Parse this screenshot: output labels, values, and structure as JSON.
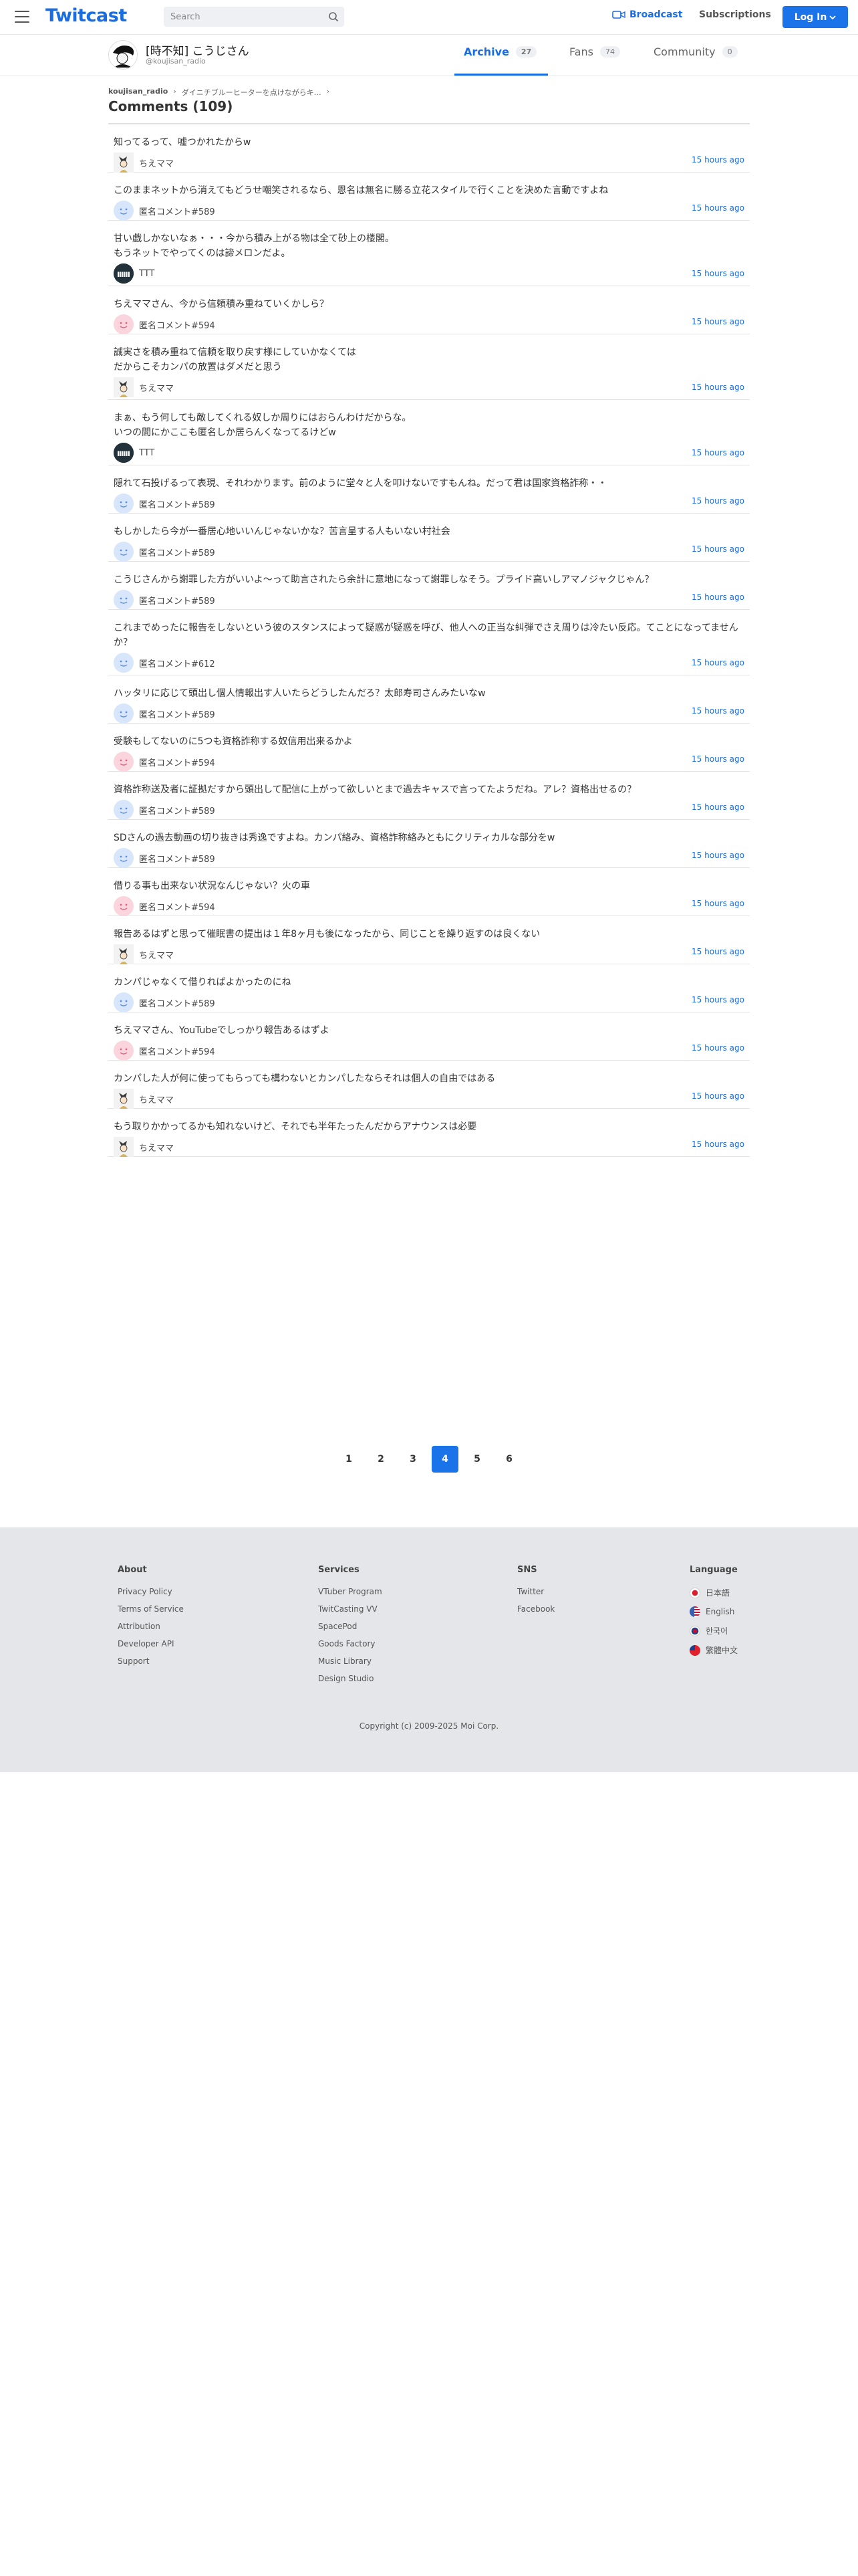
{
  "header": {
    "logo": "Twitcast",
    "search_placeholder": "Search",
    "broadcast": "Broadcast",
    "subscriptions": "Subscriptions",
    "login": "Log In"
  },
  "profile": {
    "name": "[時不知] こうじさん",
    "id": "@koujisan_radio",
    "tabs": [
      {
        "label": "Archive",
        "count": "27"
      },
      {
        "label": "Fans",
        "count": "74"
      },
      {
        "label": "Community",
        "count": "0"
      }
    ]
  },
  "breadcrumb": {
    "user": "koujisan_radio",
    "sep": "›",
    "movie": "ダイニチブルーヒーターを点けながらキ…",
    "sep2": "›"
  },
  "title": "Comments (109)",
  "comments": [
    {
      "text": "知ってるって、嘘つかれたからw",
      "user": "ちえママ",
      "avatar": "mama",
      "time": "15 hours ago"
    },
    {
      "text": "このままネットから消えてもどうせ嘲笑されるなら、恩名は無名に勝る立花スタイルで行くことを決めた言動ですよね",
      "user": "匿名コメント#589",
      "avatar": "blue",
      "time": "15 hours ago"
    },
    {
      "text": "甘い戯しかないなぁ・・・今から積み上がる物は全て砂上の楼閣。\nもうネットでやってくのは諦メロンだよ。",
      "user": "TTT",
      "avatar": "ttt",
      "time": "15 hours ago"
    },
    {
      "text": "ちえママさん、今から信頼積み重ねていくかしら？",
      "user": "匿名コメント#594",
      "avatar": "pink",
      "time": "15 hours ago"
    },
    {
      "text": "誠実さを積み重ねて信頼を取り戻す様にしていかなくては\nだからこそカンパの放置はダメだと思う",
      "user": "ちえママ",
      "avatar": "mama",
      "time": "15 hours ago"
    },
    {
      "text": "まぁ、もう何しても敵してくれる奴しか周りにはおらんわけだからな。\nいつの間にかここも匿名しか居らんくなってるけどw",
      "user": "TTT",
      "avatar": "ttt",
      "time": "15 hours ago"
    },
    {
      "text": "隠れて石投げるって表現、それわかります。前のように堂々と人を叩けないですもんね。だって君は国家資格詐称・・",
      "user": "匿名コメント#589",
      "avatar": "blue",
      "time": "15 hours ago"
    },
    {
      "text": "もしかしたら今が一番居心地いいんじゃないかな？苦言呈する人もいない村社会",
      "user": "匿名コメント#589",
      "avatar": "blue",
      "time": "15 hours ago"
    },
    {
      "text": "こうじさんから謝罪した方がいいよ〜って助言されたら余計に意地になって謝罪しなそう。プライド高いしアマノジャクじゃん？",
      "user": "匿名コメント#589",
      "avatar": "blue",
      "time": "15 hours ago"
    },
    {
      "text": "これまでめったに報告をしないという彼のスタンスによって疑惑が疑惑を呼び、他人への正当な糾弾でさえ周りは冷たい反応。てことになってませんか？",
      "user": "匿名コメント#612",
      "avatar": "blue",
      "time": "15 hours ago"
    },
    {
      "text": "ハッタリに応じて頭出し個人情報出す人いたらどうしたんだろ？太郎寿司さんみたいなw",
      "user": "匿名コメント#589",
      "avatar": "blue",
      "time": "15 hours ago"
    },
    {
      "text": "受験もしてないのに5つも資格詐称する奴信用出来るかよ",
      "user": "匿名コメント#594",
      "avatar": "pink",
      "time": "15 hours ago"
    },
    {
      "text": "資格詐称送及者に証拠だすから頭出して配信に上がって欲しいとまで過去キャスで言ってたようだね。アレ？資格出せるの？",
      "user": "匿名コメント#589",
      "avatar": "blue",
      "time": "15 hours ago"
    },
    {
      "text": "SDさんの過去動画の切り抜きは秀逸ですよね。カンパ絡み、資格詐称絡みともにクリティカルな部分をw",
      "user": "匿名コメント#589",
      "avatar": "blue",
      "time": "15 hours ago"
    },
    {
      "text": "借りる事も出来ない状況なんじゃない？火の車",
      "user": "匿名コメント#594",
      "avatar": "pink",
      "time": "15 hours ago"
    },
    {
      "text": "報告あるはずと思って催眠書の提出は１年8ヶ月も後になったから、同じことを繰り返すのは良くない",
      "user": "ちえママ",
      "avatar": "mama",
      "time": "15 hours ago"
    },
    {
      "text": "カンパじゃなくて借りればよかったのにね",
      "user": "匿名コメント#589",
      "avatar": "blue",
      "time": "15 hours ago"
    },
    {
      "text": "ちえママさん、YouTubeでしっかり報告あるはずよ",
      "user": "匿名コメント#594",
      "avatar": "pink",
      "time": "15 hours ago"
    },
    {
      "text": "カンパした人が何に使ってもらっても構わないとカンパしたならそれは個人の自由ではある",
      "user": "ちえママ",
      "avatar": "mama",
      "time": "15 hours ago"
    },
    {
      "text": "もう取りかかってるかも知れないけど、それでも半年たったんだからアナウンスは必要",
      "user": "ちえママ",
      "avatar": "mama",
      "time": "15 hours ago"
    }
  ],
  "pagination": {
    "pages": [
      "1",
      "2",
      "3",
      "4",
      "5",
      "6"
    ],
    "current": "4"
  },
  "footer": {
    "about": {
      "title": "About",
      "links": [
        "Privacy Policy",
        "Terms of Service",
        "Attribution",
        "Developer API",
        "Support"
      ]
    },
    "services": {
      "title": "Services",
      "links": [
        "VTuber Program",
        "TwitCasting VV",
        "SpacePod",
        "Goods Factory",
        "Music Library",
        "Design Studio"
      ]
    },
    "sns": {
      "title": "SNS",
      "links": [
        "Twitter",
        "Facebook"
      ]
    },
    "language": {
      "title": "Language",
      "items": [
        {
          "label": "日本語",
          "color": "#d81e2b"
        },
        {
          "label": "English",
          "color": "#3b5fb0"
        },
        {
          "label": "한국어",
          "color": "#c8102e"
        },
        {
          "label": "繁體中文",
          "color": "#e0202a"
        }
      ]
    },
    "copyright": "Copyright (c) 2009-2025 Moi Corp."
  },
  "colors": {
    "accent": "#1a6de0",
    "login_bg": "#1a73e8",
    "footer_bg": "#e4e6ea"
  }
}
